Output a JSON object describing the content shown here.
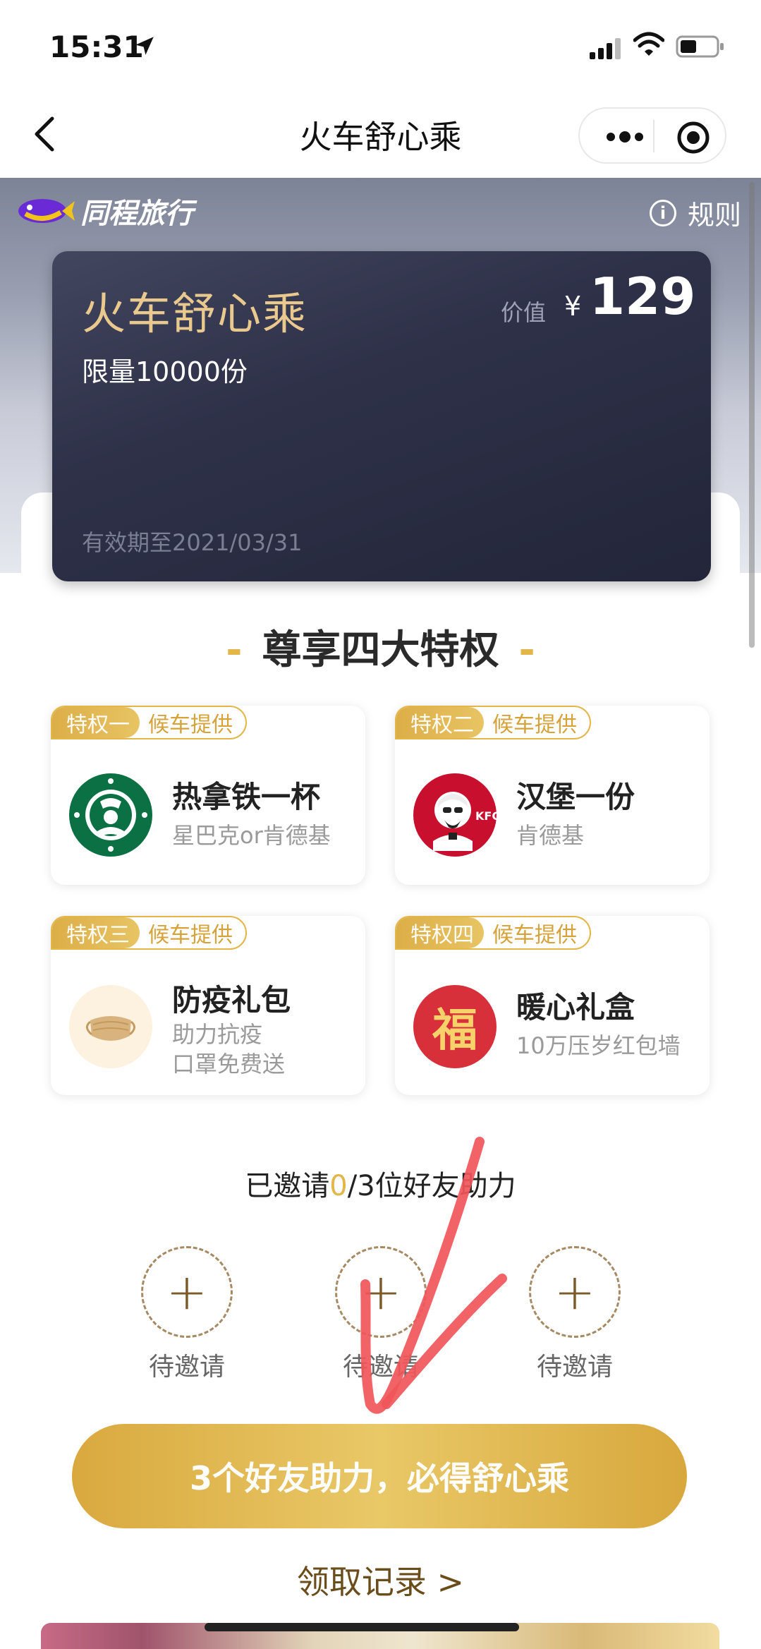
{
  "status_bar": {
    "time": "15:31"
  },
  "nav": {
    "title": "火车舒心乘"
  },
  "header": {
    "brand": "同程旅行",
    "rules": "规则",
    "info_glyph": "i"
  },
  "card": {
    "title": "火车舒心乘",
    "limit": "限量10000份",
    "value_label": "价值",
    "currency": "¥",
    "price": "129",
    "expiry": "有效期至2021/03/31"
  },
  "privileges": {
    "section_title": "尊享四大特权",
    "items": [
      {
        "tag": "特权一",
        "provider": "候车提供",
        "name": "热拿铁一杯",
        "desc": "星巴克or肯德基",
        "icon": "starbucks-logo"
      },
      {
        "tag": "特权二",
        "provider": "候车提供",
        "name": "汉堡一份",
        "desc": "肯德基",
        "icon": "kfc-logo"
      },
      {
        "tag": "特权三",
        "provider": "候车提供",
        "name": "防疫礼包",
        "desc": "助力抗疫",
        "desc2": "口罩免费送",
        "icon": "mask-icon"
      },
      {
        "tag": "特权四",
        "provider": "候车提供",
        "name": "暖心礼盒",
        "desc": "10万压岁红包墙",
        "icon": "fu-icon",
        "fu": "福"
      }
    ]
  },
  "invite": {
    "prefix": "已邀请",
    "count": "0",
    "suffix": "/3位好友助力",
    "slots": [
      {
        "label": "待邀请"
      },
      {
        "label": "待邀请"
      },
      {
        "label": "待邀请"
      }
    ]
  },
  "cta": {
    "label": "3个好友助力，必得舒心乘"
  },
  "records": {
    "label": "领取记录 >"
  },
  "colors": {
    "gold": "#e3b64a",
    "card_bg": "#2e3148",
    "annotation": "#f0565a"
  }
}
